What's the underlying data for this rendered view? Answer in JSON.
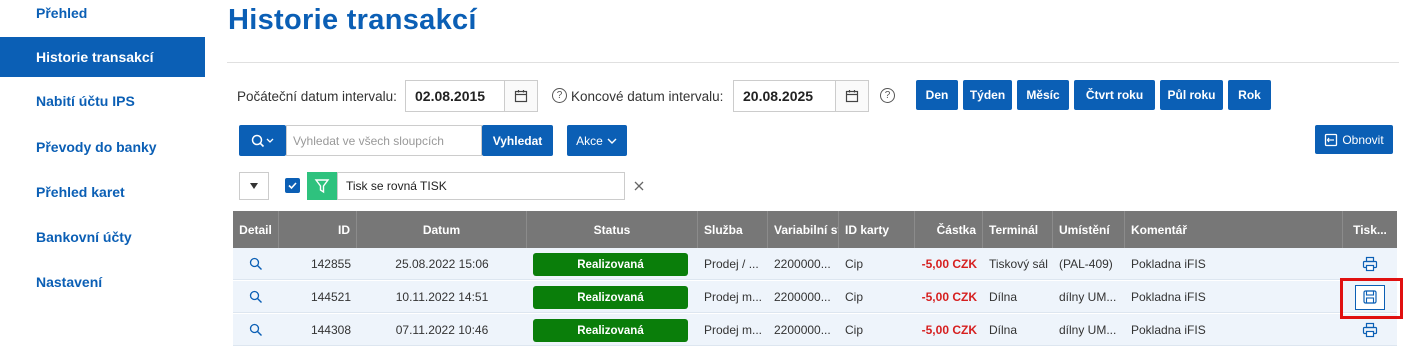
{
  "sidebar": {
    "items": [
      {
        "label": "Přehled"
      },
      {
        "label": "Historie transakcí"
      },
      {
        "label": "Nabití účtu IPS"
      },
      {
        "label": "Převody do banky"
      },
      {
        "label": "Přehled karet"
      },
      {
        "label": "Bankovní účty"
      },
      {
        "label": "Nastavení"
      }
    ],
    "active_index": 1
  },
  "page": {
    "title": "Historie transakcí"
  },
  "interval": {
    "start_label": "Počáteční datum intervalu:",
    "start_value": "02.08.2015",
    "end_label": "Koncové datum intervalu:",
    "end_value": "20.08.2025",
    "help_glyph": "?"
  },
  "periods": [
    "Den",
    "Týden",
    "Měsíc",
    "Čtvrt roku",
    "Půl roku",
    "Rok"
  ],
  "toolbar": {
    "search_placeholder": "Vyhledat ve všech sloupcích",
    "search_button": "Vyhledat",
    "actions_button": "Akce",
    "refresh_button": "Obnovit"
  },
  "filter": {
    "text": "Tisk se rovná TISK",
    "checked": true
  },
  "table": {
    "columns": [
      "Detail",
      "ID",
      "Datum",
      "Status",
      "Služba",
      "Variabilní sy",
      "ID karty",
      "Částka",
      "Terminál",
      "Umístění",
      "Komentář",
      "Tisk..."
    ],
    "rows": [
      {
        "id": "142855",
        "date": "25.08.2022 15:06",
        "status": "Realizovaná",
        "service": "Prodej / ...",
        "vs": "2200000...",
        "card": "Cip",
        "amount": "-5,00 CZK",
        "terminal": "Tiskový sál",
        "location": "(PAL-409)",
        "comment": "Pokladna iFIS",
        "print_icon": "printer-icon"
      },
      {
        "id": "144521",
        "date": "10.11.2022 14:51",
        "status": "Realizovaná",
        "service": "Prodej m...",
        "vs": "2200000...",
        "card": "Cip",
        "amount": "-5,00 CZK",
        "terminal": "Dílna",
        "location": "dílny UM...",
        "comment": "Pokladna iFIS",
        "print_icon": "save-icon"
      },
      {
        "id": "144308",
        "date": "07.11.2022 10:46",
        "status": "Realizovaná",
        "service": "Prodej m...",
        "vs": "2200000...",
        "card": "Cip",
        "amount": "-5,00 CZK",
        "terminal": "Dílna",
        "location": "dílny UM...",
        "comment": "Pokladna iFIS",
        "print_icon": "printer-icon"
      }
    ]
  },
  "colors": {
    "brand": "#0b5fb5",
    "status_ok": "#0a7e0a",
    "negative": "#d61f1f",
    "header_bg": "#777777",
    "filter_icon_bg": "#2ec27e",
    "highlight": "#e01010"
  }
}
